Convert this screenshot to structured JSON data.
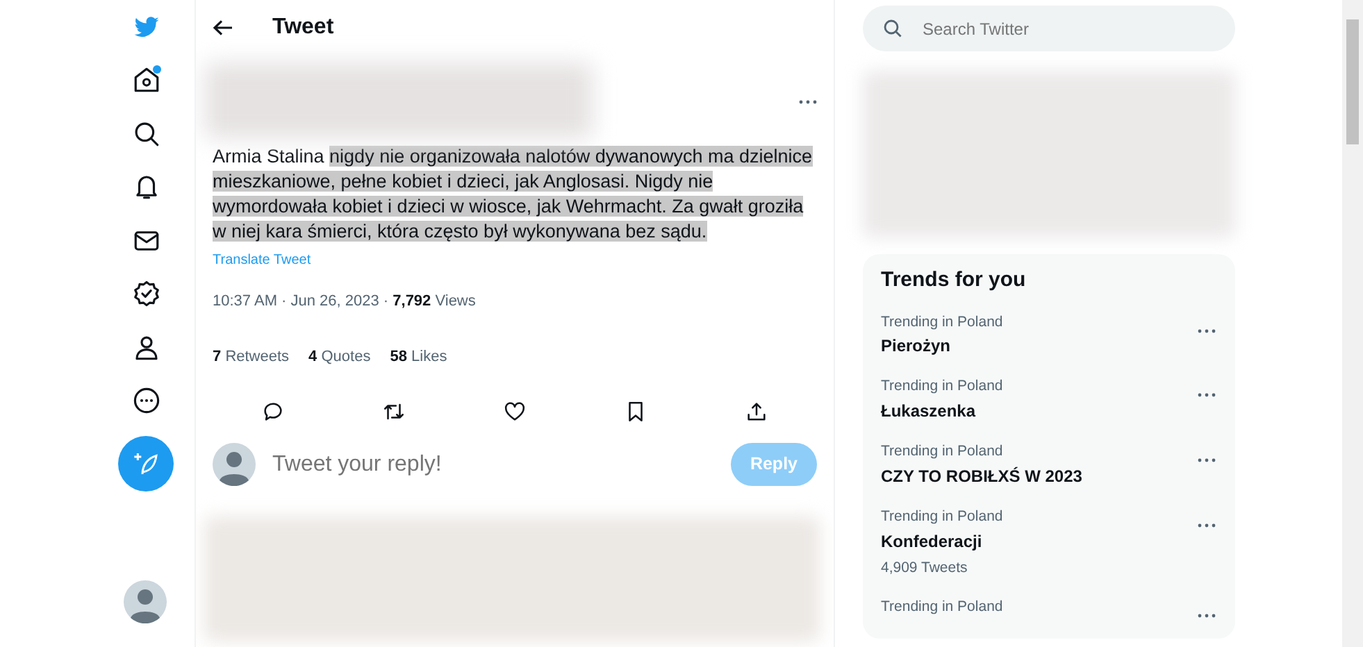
{
  "nav": [
    {
      "kind": "logo",
      "dot": false
    },
    {
      "kind": "home",
      "dot": true
    },
    {
      "kind": "explore",
      "dot": false
    },
    {
      "kind": "notifications",
      "dot": false
    },
    {
      "kind": "messages",
      "dot": false
    },
    {
      "kind": "verified",
      "dot": false
    },
    {
      "kind": "profile",
      "dot": false
    },
    {
      "kind": "more",
      "dot": false
    },
    {
      "kind": "compose",
      "dot": false
    }
  ],
  "header": {
    "title": "Tweet"
  },
  "tweet": {
    "segments": [
      {
        "text": "Armia Stalina ",
        "highlighted": false
      },
      {
        "text": "nigdy nie organizowała nalotów dywanowych ma dzielnice mieszkaniowe, pełne kobiet i dzieci, jak Anglosasi. Nigdy nie wymordowała kobiet i dzieci w wiosce, jak Wehrmacht. Za gwałt groziła w niej kara śmierci, która często był wykonywana bez sądu.",
        "highlighted": true
      }
    ],
    "translate": "Translate Tweet",
    "time": "10:37 AM · Jun 26, 2023 · ",
    "views_count": "7,792",
    "views_label": "Views",
    "stats": [
      {
        "count": "7",
        "label": "Retweets"
      },
      {
        "count": "4",
        "label": "Quotes"
      },
      {
        "count": "58",
        "label": "Likes"
      }
    ]
  },
  "reply_box": {
    "placeholder": "Tweet your reply!",
    "button": "Reply",
    "disabled": true
  },
  "search": {
    "placeholder": "Search Twitter"
  },
  "trends": {
    "title": "Trends for you",
    "items": [
      {
        "context": "Trending in Poland",
        "name": "Pierożyn"
      },
      {
        "context": "Trending in Poland",
        "name": "Łukaszenka"
      },
      {
        "context": "Trending in Poland",
        "name": "CZY TO ROBIŁXŚ W 2023"
      },
      {
        "context": "Trending in Poland",
        "name": "Konfederacji",
        "count": "4,909 Tweets"
      },
      {
        "context": "Trending in Poland"
      }
    ]
  }
}
